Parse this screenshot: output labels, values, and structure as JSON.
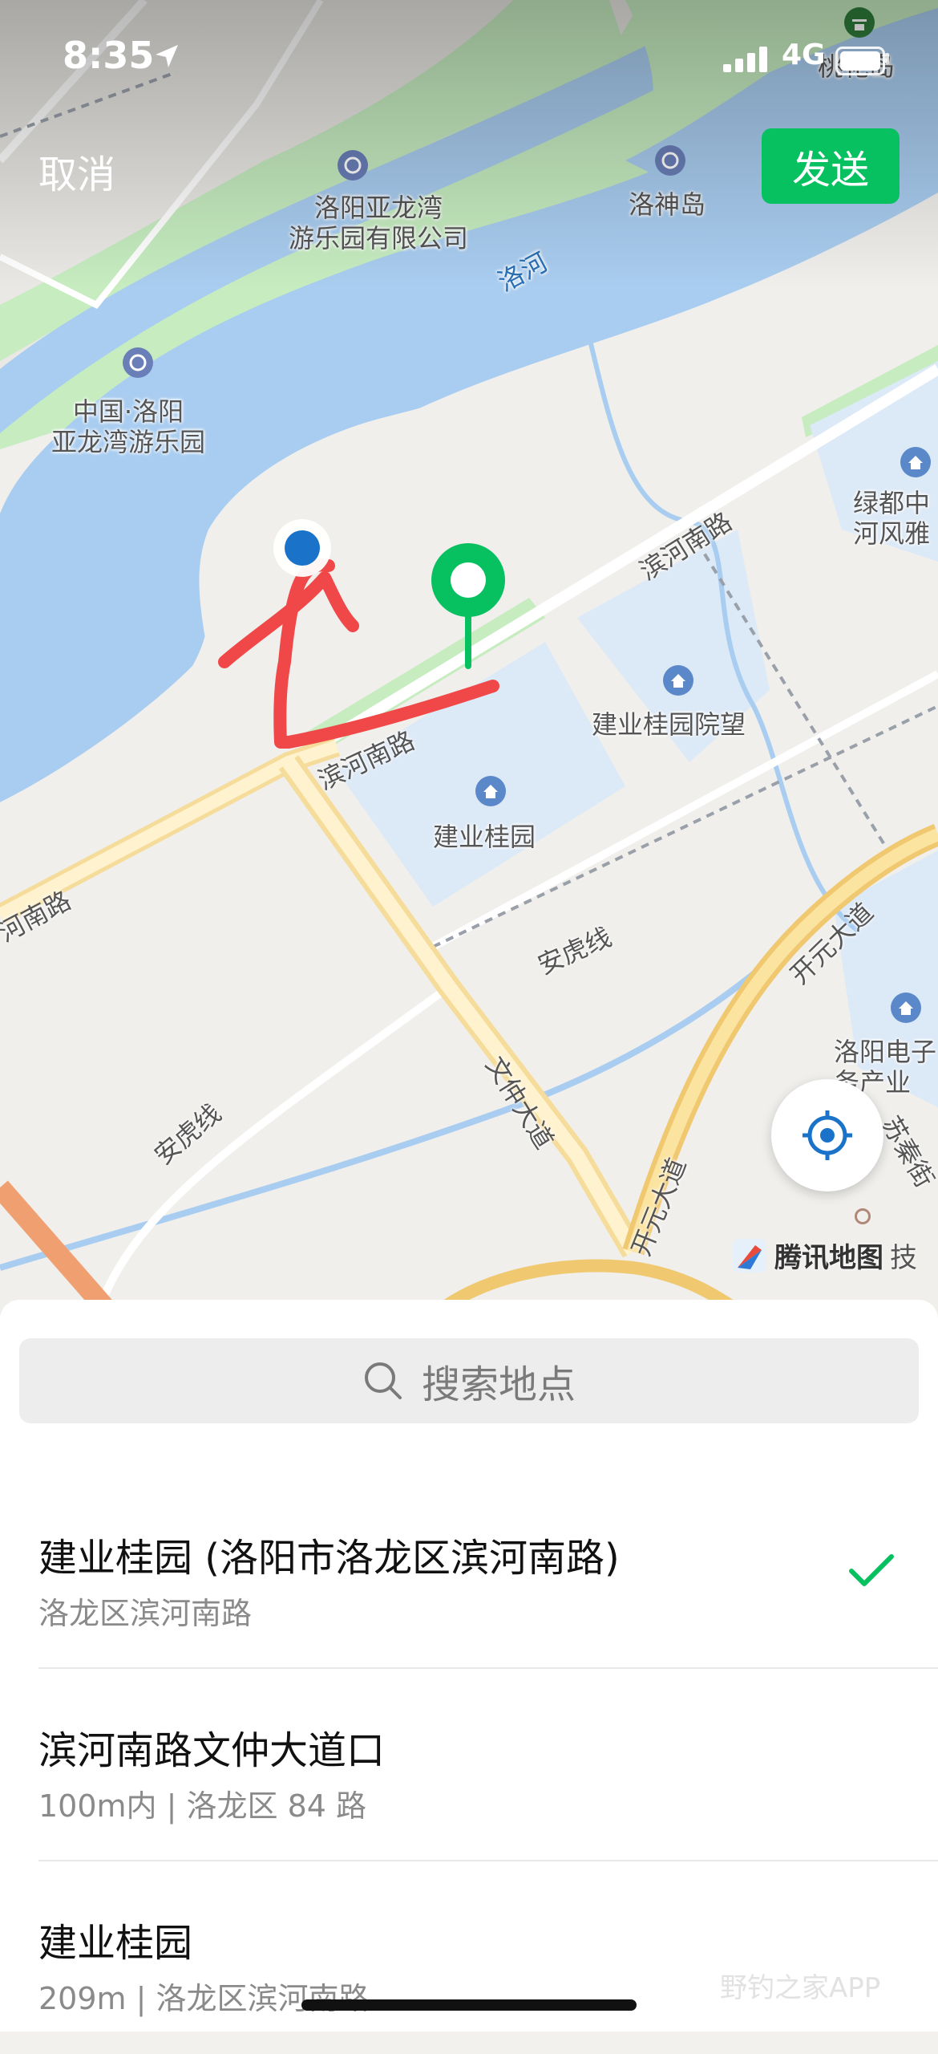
{
  "status_bar": {
    "time": "8:35",
    "network": "4G"
  },
  "header": {
    "cancel_label": "取消",
    "send_label": "发送"
  },
  "map": {
    "pois": [
      {
        "label": "洛阳亚龙湾\n游乐园有限公司",
        "icon": "ferris-wheel-icon"
      },
      {
        "label": "洛神岛",
        "icon": "ferris-wheel-icon"
      },
      {
        "label": "中国·洛阳\n亚龙湾游乐园",
        "icon": "ferris-wheel-icon"
      },
      {
        "label": "桃花岛",
        "icon": "temple-icon"
      },
      {
        "label": "绿都中\n河风雅",
        "icon": "home-icon"
      },
      {
        "label": "建业桂园院望",
        "icon": "home-icon"
      },
      {
        "label": "建业桂园",
        "icon": "home-icon"
      },
      {
        "label": "洛阳电子\n务产业",
        "icon": "home-icon"
      }
    ],
    "river_label": "洛河",
    "roads": [
      "滨河南路",
      "滨河南路",
      "河南路",
      "安虎线",
      "安虎线",
      "文仲大道",
      "开元大道",
      "开元大道",
      "苏秦街"
    ],
    "logo": "腾讯地图",
    "logo_suffix": "技",
    "colors": {
      "water": "#a9cdf0",
      "green": "#c6ecc0",
      "residential": "#dce9f7",
      "pin": "#07c160",
      "my_location": "#1a73c8",
      "annotation": "#f04848"
    }
  },
  "search": {
    "placeholder": "搜索地点"
  },
  "places": [
    {
      "title": "建业桂园 (洛阳市洛龙区滨河南路)",
      "subtitle": "洛龙区滨河南路",
      "selected": true
    },
    {
      "title": "滨河南路文仲大道口",
      "subtitle": "100m内 | 洛龙区 84 路",
      "selected": false
    },
    {
      "title": "建业桂园",
      "subtitle": "209m | 洛龙区滨河南路",
      "selected": false
    }
  ],
  "watermark": "野钓之家APP"
}
